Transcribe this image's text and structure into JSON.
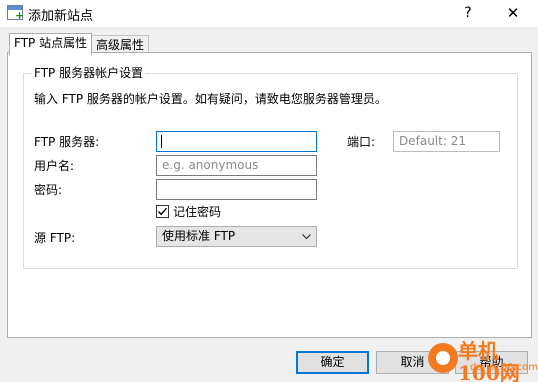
{
  "window": {
    "title": "添加新站点",
    "help_glyph": "?",
    "close_glyph": "✕"
  },
  "tabs": [
    {
      "label": "FTP 站点属性",
      "active": true
    },
    {
      "label": "高级属性",
      "active": false
    }
  ],
  "group": {
    "title": "FTP 服务器帐户设置",
    "instruction": "输入 FTP 服务器的帐户设置。如有疑问，请致电您服务器管理员。"
  },
  "form": {
    "server_label": "FTP 服务器:",
    "server_value": "",
    "port_label": "端口:",
    "port_placeholder": "Default: 21",
    "username_label": "用户名:",
    "username_placeholder": "e.g. anonymous",
    "password_label": "密码:",
    "password_value": "",
    "remember_label": "记住密码",
    "remember_checked": true,
    "source_label": "源 FTP:",
    "source_value": "使用标准 FTP"
  },
  "buttons": {
    "ok": "确定",
    "cancel": "取消",
    "help": "帮助"
  },
  "watermark": {
    "title": "单机100网",
    "url": "danji100.com"
  },
  "colors": {
    "focus": "#0078d7",
    "watermark": "#f47a20"
  }
}
